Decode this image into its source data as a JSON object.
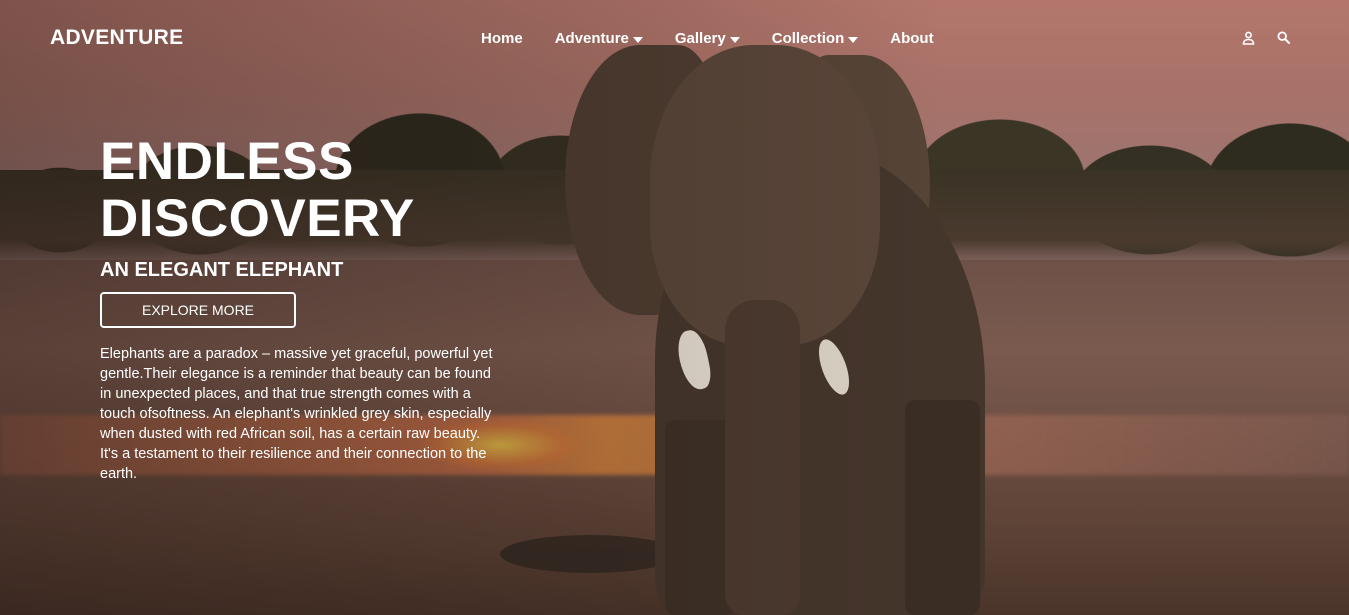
{
  "header": {
    "logo": "ADVENTURE",
    "nav": [
      {
        "label": "Home",
        "dropdown": false
      },
      {
        "label": "Adventure",
        "dropdown": true
      },
      {
        "label": "Gallery",
        "dropdown": true
      },
      {
        "label": "Collection",
        "dropdown": true
      },
      {
        "label": "About",
        "dropdown": false
      }
    ],
    "icons": [
      "user-icon",
      "search-icon"
    ]
  },
  "hero": {
    "title_line1": "ENDLESS",
    "title_line2": "DISCOVERY",
    "subtitle": "AN ELEGANT ELEPHANT",
    "cta_label": "EXPLORE MORE",
    "description": "Elephants are a paradox – massive yet graceful, powerful yet gentle.Their elegance is a reminder that beauty can be found in unexpected places, and that true strength comes with a touch ofsoftness. An elephant's wrinkled grey skin, especially when dusted with red African soil, has a certain raw beauty. It's a testament to their resilience and their connection to the earth."
  },
  "colors": {
    "text": "#ffffff",
    "sky": "#b3766c",
    "ground": "#6e5148"
  }
}
